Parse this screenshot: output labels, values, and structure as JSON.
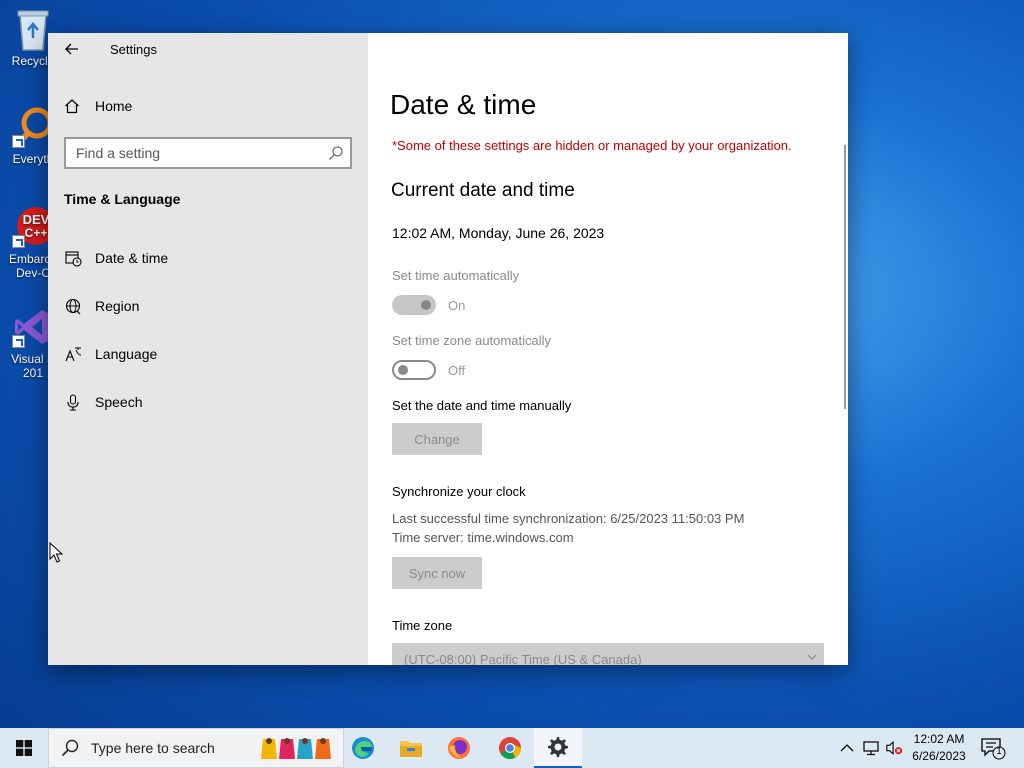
{
  "desktop": {
    "icons": [
      {
        "label": "Recycle"
      },
      {
        "label": "Everyth"
      },
      {
        "label": "Embarca",
        "label2": "Dev-C"
      },
      {
        "label": "Visual S",
        "label2": "201"
      }
    ]
  },
  "window": {
    "title": "Settings"
  },
  "sidebar": {
    "home": "Home",
    "search_placeholder": "Find a setting",
    "section": "Time & Language",
    "items": [
      {
        "label": "Date & time",
        "icon": "clock-calendar-icon"
      },
      {
        "label": "Region",
        "icon": "globe-icon"
      },
      {
        "label": "Language",
        "icon": "language-icon"
      },
      {
        "label": "Speech",
        "icon": "microphone-icon"
      }
    ]
  },
  "content": {
    "title": "Date & time",
    "org_note": "*Some of these settings are hidden or managed by your organization.",
    "current_heading": "Current date and time",
    "current_value": "12:02 AM, Monday, June 26, 2023",
    "set_time_auto_label": "Set time automatically",
    "set_time_auto_state": "On",
    "set_tz_auto_label": "Set time zone automatically",
    "set_tz_auto_state": "Off",
    "manual_label": "Set the date and time manually",
    "change_button": "Change",
    "sync_heading": "Synchronize your clock",
    "last_sync": "Last successful time synchronization: 6/25/2023 11:50:03 PM",
    "time_server": "Time server: time.windows.com",
    "sync_button": "Sync now",
    "timezone_heading": "Time zone",
    "timezone_value": "(UTC-08:00) Pacific Time (US & Canada)"
  },
  "taskbar": {
    "search_placeholder": "Type here to search",
    "clock_time": "12:02 AM",
    "clock_date": "6/26/2023",
    "notification_count": "1"
  },
  "colors": {
    "accent": "#0a64c8",
    "warning_text": "#c50000",
    "sidebar_bg": "#e6e6e6"
  }
}
